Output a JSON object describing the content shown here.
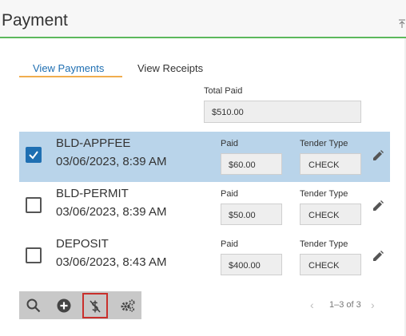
{
  "header": {
    "title": "Payment",
    "collapse_icon": "collapse-up-icon"
  },
  "tabs": [
    {
      "label": "View Payments",
      "active": true
    },
    {
      "label": "View Receipts",
      "active": false
    }
  ],
  "total": {
    "label": "Total Paid",
    "value": "$510.00"
  },
  "payments": [
    {
      "code": "BLD-APPFEE",
      "date": "03/06/2023, 8:39 AM",
      "paid_label": "Paid",
      "paid": "$60.00",
      "tender_label": "Tender Type",
      "tender": "CHECK",
      "selected": true
    },
    {
      "code": "BLD-PERMIT",
      "date": "03/06/2023, 8:39 AM",
      "paid_label": "Paid",
      "paid": "$50.00",
      "tender_label": "Tender Type",
      "tender": "CHECK",
      "selected": false
    },
    {
      "code": "DEPOSIT",
      "date": "03/06/2023, 8:43 AM",
      "paid_label": "Paid",
      "paid": "$400.00",
      "tender_label": "Tender Type",
      "tender": "CHECK",
      "selected": false
    }
  ],
  "toolbar": {
    "icons": [
      "search-icon",
      "add-circle-icon",
      "no-dollar-icon",
      "settings-gears-icon"
    ]
  },
  "pager": {
    "info": "1–3 of 3",
    "prev": "‹",
    "next": "›"
  },
  "colors": {
    "accent": "#1f6fb2",
    "selected_row": "#b9d4ea",
    "header_line": "#5cb85c",
    "tab_underline": "#f0ad4e",
    "highlight": "#c9302c"
  }
}
